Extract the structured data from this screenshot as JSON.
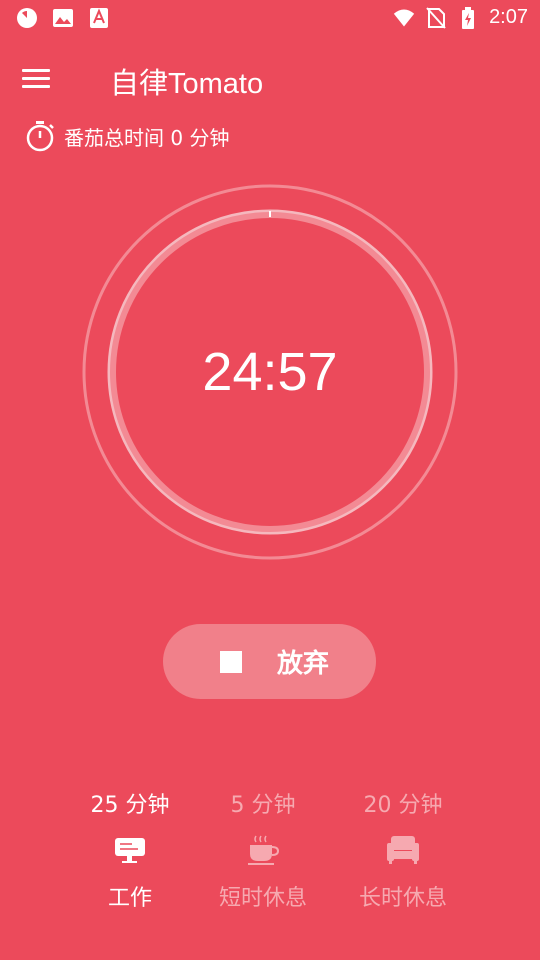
{
  "status_bar": {
    "time": "2:07",
    "left_icons": [
      "pomodoro-notification-icon",
      "image-icon",
      "text-tool-icon"
    ],
    "right_icons": [
      "wifi-icon",
      "no-sim-icon",
      "battery-charging-icon"
    ]
  },
  "app_bar": {
    "title": "自律Tomato",
    "menu_icon": "hamburger-menu-icon"
  },
  "summary": {
    "label": "番茄总时间 0 分钟",
    "icon": "stopwatch-icon"
  },
  "timer": {
    "remaining": "24:57"
  },
  "action_button": {
    "label": "放弃",
    "icon": "stop-icon"
  },
  "modes": [
    {
      "duration": "25 分钟",
      "label": "工作",
      "icon": "desk-icon",
      "active": true
    },
    {
      "duration": "5 分钟",
      "label": "短时休息",
      "icon": "coffee-cup-icon",
      "active": false
    },
    {
      "duration": "20 分钟",
      "label": "长时休息",
      "icon": "armchair-icon",
      "active": false
    }
  ],
  "colors": {
    "background": "#EC4A5B",
    "button": "#F1808A",
    "inactive_text": "#F6A9B0"
  }
}
